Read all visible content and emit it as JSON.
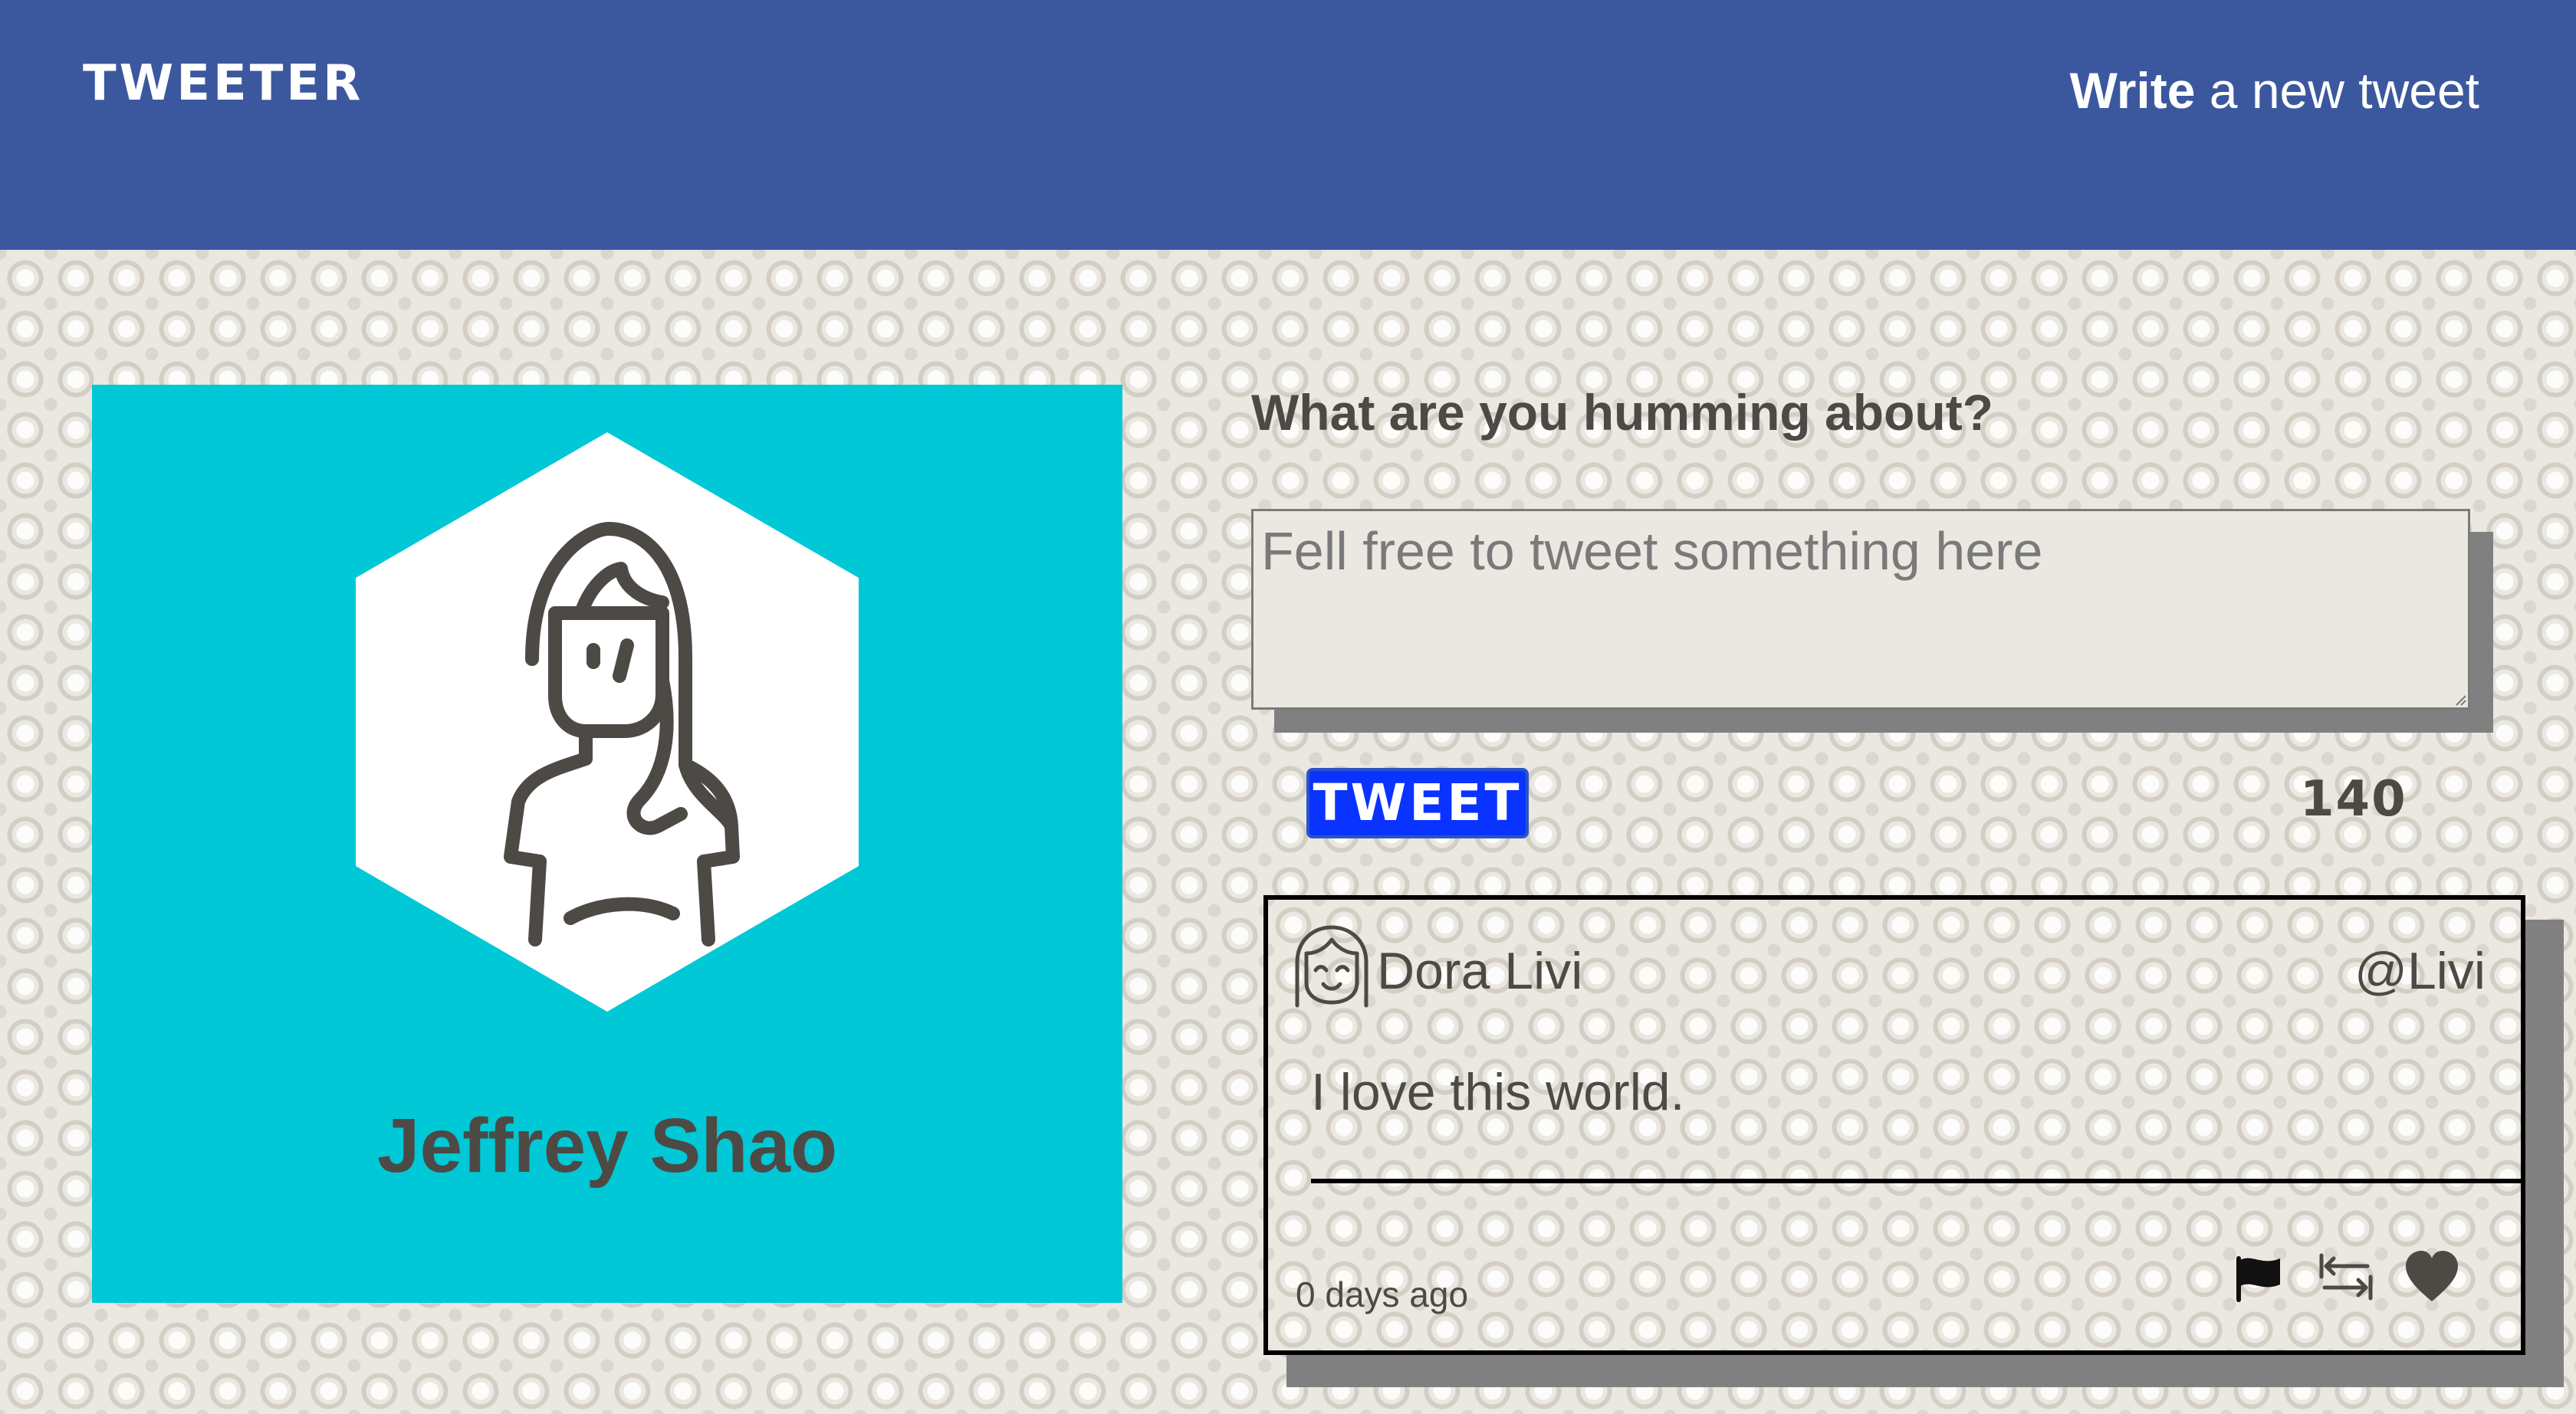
{
  "header": {
    "brand": "TWEETER",
    "compose_bold": "Write",
    "compose_rest": " a new tweet"
  },
  "profile": {
    "name": "Jeffrey Shao",
    "avatar_icon": "woman-avatar-icon"
  },
  "composer": {
    "prompt": "What are you humming about?",
    "placeholder": "Fell free to tweet something here",
    "value": "",
    "button_label": "TWEET",
    "char_count": "140"
  },
  "tweets": [
    {
      "author": "Dora Livi",
      "handle": "@Livi",
      "body": "I love this world.",
      "time": "0 days ago",
      "avatar_icon": "smiling-girl-avatar-icon",
      "actions": [
        "flag-icon",
        "retweet-icon",
        "heart-icon"
      ]
    }
  ],
  "colors": {
    "header_bg": "#3b589f",
    "profile_bg": "#00c8d6",
    "tweet_button_bg": "#0a33ff",
    "text": "#4d4a46",
    "shadow": "#808080"
  }
}
